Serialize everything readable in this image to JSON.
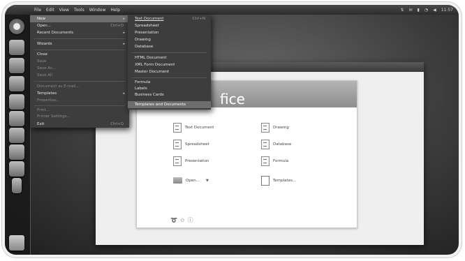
{
  "topbar": {
    "menus": [
      "File",
      "Edit",
      "View",
      "Tools",
      "Window",
      "Help"
    ],
    "time": "11:57"
  },
  "file_menu": {
    "items": [
      {
        "label": "New",
        "shortcut": "",
        "submenu": true,
        "selected": true
      },
      {
        "label": "Open...",
        "shortcut": "Ctrl+O",
        "submenu": false
      },
      {
        "label": "Recent Documents",
        "shortcut": "",
        "submenu": true
      },
      {
        "label": "Wizards",
        "shortcut": "",
        "submenu": true
      },
      {
        "label": "Close",
        "shortcut": "",
        "submenu": false
      },
      {
        "label": "Save",
        "shortcut": "",
        "disabled": true
      },
      {
        "label": "Save As...",
        "shortcut": "",
        "disabled": true
      },
      {
        "label": "Save All",
        "shortcut": "",
        "disabled": true
      },
      {
        "label": "Document as E-mail...",
        "shortcut": "",
        "disabled": true
      },
      {
        "label": "Templates",
        "shortcut": "",
        "submenu": true
      },
      {
        "label": "Properties...",
        "shortcut": "",
        "disabled": true
      },
      {
        "label": "Print...",
        "shortcut": "",
        "disabled": true
      },
      {
        "label": "Printer Settings...",
        "shortcut": "",
        "disabled": true
      },
      {
        "label": "Exit",
        "shortcut": "Ctrl+Q"
      }
    ]
  },
  "new_submenu": {
    "items": [
      {
        "label": "Text Document",
        "shortcut": "Ctrl+N"
      },
      {
        "label": "Spreadsheet"
      },
      {
        "label": "Presentation"
      },
      {
        "label": "Drawing"
      },
      {
        "label": "Database"
      },
      {
        "label": "HTML Document"
      },
      {
        "label": "XML Form Document"
      },
      {
        "label": "Master Document"
      },
      {
        "label": "Formula"
      },
      {
        "label": "Labels"
      },
      {
        "label": "Business Cards"
      },
      {
        "label": "Templates and Documents",
        "selected": true
      }
    ]
  },
  "start_center": {
    "banner_text": "fice",
    "left_column": [
      "Text Document",
      "Spreadsheet",
      "Presentation"
    ],
    "right_column": [
      "Drawing",
      "Database",
      "Formula"
    ],
    "open_label": "Open...",
    "templates_label": "Templates..."
  }
}
